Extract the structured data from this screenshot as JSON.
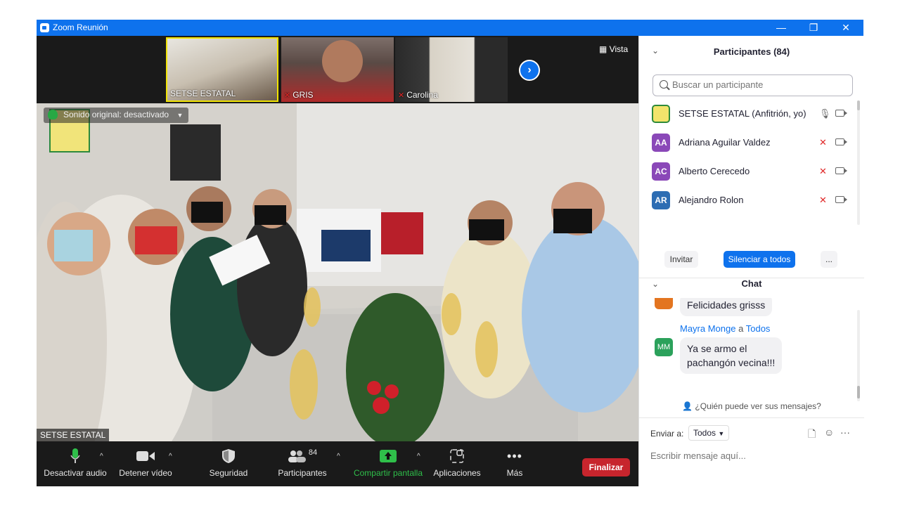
{
  "window": {
    "title": "Zoom Reunión",
    "min": "—",
    "max": "❐",
    "close": "✕"
  },
  "strip": {
    "thumbs": [
      {
        "name": "SETSE ESTATAL",
        "muted": false
      },
      {
        "name": "GRIS",
        "muted": true
      },
      {
        "name": "Carolina",
        "muted": true
      }
    ],
    "next": "›",
    "view_label": "Vista"
  },
  "main_video": {
    "original_sound": "Sonido original: desactivado",
    "speaker": "SETSE ESTATAL"
  },
  "toolbar": {
    "audio": "Desactivar audio",
    "video": "Detener vídeo",
    "security": "Seguridad",
    "participants": "Participantes",
    "participants_count": "84",
    "share": "Compartir pantalla",
    "apps": "Aplicaciones",
    "more": "Más",
    "end": "Finalizar"
  },
  "participants_panel": {
    "title": "Participantes (84)",
    "search_placeholder": "Buscar un participante",
    "list": [
      {
        "initials": "",
        "name": "SETSE ESTATAL (Anfitrión, yo)",
        "muted": false
      },
      {
        "initials": "AA",
        "name": "Adriana Aguilar Valdez",
        "muted": true
      },
      {
        "initials": "AC",
        "name": "Alberto Cerecedo",
        "muted": true
      },
      {
        "initials": "AR",
        "name": "Alejandro Rolon",
        "muted": true
      }
    ],
    "invite": "Invitar",
    "mute_all": "Silenciar a todos",
    "more": "..."
  },
  "chat": {
    "title": "Chat",
    "prev_message": "Felicidades grisss",
    "sender_name": "Mayra Monge",
    "sender_to_word": "a",
    "sender_target": "Todos",
    "sender_initials": "MM",
    "message_line1": "Ya se armo el",
    "message_line2": "pachangón vecina!!!",
    "who_can_see": "¿Quién puede ver sus mensajes?",
    "send_to_label": "Enviar a:",
    "send_to_value": "Todos",
    "input_placeholder": "Escribir mensaje aquí..."
  }
}
